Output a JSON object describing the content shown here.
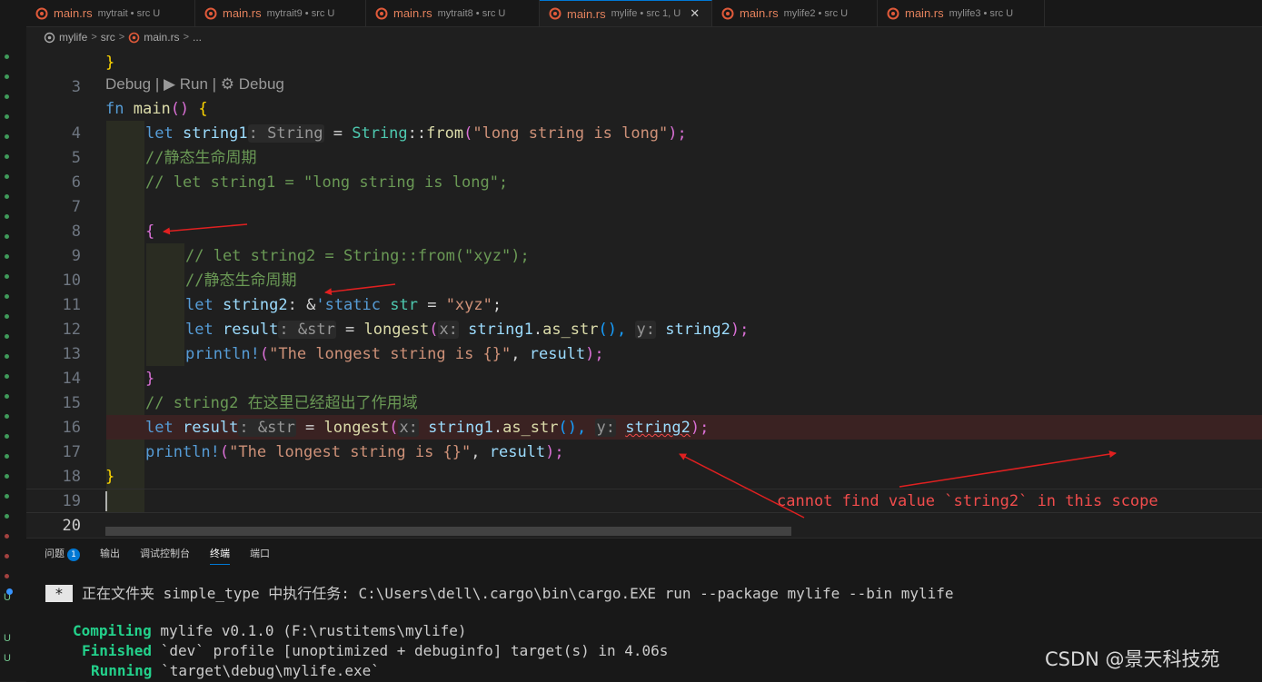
{
  "tabs": [
    {
      "name": "main.rs",
      "desc": "mytrait • src U",
      "active": false,
      "icon": "rust-icon"
    },
    {
      "name": "main.rs",
      "desc": "mytrait9 • src U",
      "active": false,
      "icon": "rust-icon"
    },
    {
      "name": "main.rs",
      "desc": "mytrait8 • src U",
      "active": false,
      "icon": "rust-icon"
    },
    {
      "name": "main.rs",
      "desc": "mylife • src 1, U",
      "active": true,
      "icon": "rust-icon",
      "close": "✕"
    },
    {
      "name": "main.rs",
      "desc": "mylife2 • src U",
      "active": false,
      "icon": "rust-icon"
    },
    {
      "name": "main.rs",
      "desc": "mylife3 • src U",
      "active": false,
      "icon": "rust-icon"
    }
  ],
  "breadcrumb": {
    "items": [
      "mylife",
      "src",
      "main.rs",
      "..."
    ],
    "separator": ">"
  },
  "codelens": "Debug | ▶ Run | ⚙ Debug",
  "editor": {
    "line_numbers": [
      "3",
      "4",
      "5",
      "6",
      "7",
      "8",
      "9",
      "10",
      "11",
      "12",
      "13",
      "14",
      "15",
      "16",
      "17",
      "18",
      "19",
      "20"
    ],
    "current_line": "20",
    "lines": {
      "l3": [
        "}"
      ],
      "l4": [
        "fn",
        " ",
        "main",
        "() ",
        "{"
      ],
      "l5": [
        "let",
        " ",
        "string1",
        ": String",
        " = ",
        "String",
        "::",
        "from",
        "(",
        "\"long string is long\"",
        ");"
      ],
      "l6": [
        "//静态生命周期"
      ],
      "l7": [
        "// let string1 = \"long string is long\";"
      ],
      "l9": [
        "{"
      ],
      "l10": [
        "// let string2 = String::from(\"xyz\");"
      ],
      "l11": [
        "//静态生命周期"
      ],
      "l12": [
        "let",
        " ",
        "string2",
        ": &",
        "'static",
        " ",
        "str",
        " = ",
        "\"xyz\"",
        ";"
      ],
      "l13": [
        "let",
        " ",
        "result",
        ": &str",
        " = ",
        "longest",
        "(",
        "x:",
        " ",
        "string1",
        ".",
        "as_str",
        "(),",
        " ",
        "y:",
        " ",
        "string2",
        ");"
      ],
      "l14": [
        "println!",
        "(",
        "\"The longest string is {}\"",
        ", ",
        "result",
        ");"
      ],
      "l15": [
        "}"
      ],
      "l16": [
        "// string2 在这里已经超出了作用域"
      ],
      "l17": [
        "let",
        " ",
        "result",
        ": &str",
        " = ",
        "longest",
        "(",
        "x:",
        " ",
        "string1",
        ".",
        "as_str",
        "(),",
        " ",
        "y:",
        " ",
        "string2",
        ");"
      ],
      "l18": [
        "println!",
        "(",
        "\"The longest string is {}\"",
        ", ",
        "result",
        ");"
      ],
      "l19": [
        "}"
      ]
    },
    "error_message": "cannot find value `string2` in this scope"
  },
  "panel": {
    "tabs": [
      "问题",
      "输出",
      "调试控制台",
      "终端",
      "端口"
    ],
    "active_tab": "终端",
    "problems_count": "1"
  },
  "terminal": {
    "task_marker": "*",
    "task_line": "正在文件夹 simple_type 中执行任务: C:\\Users\\dell\\.cargo\\bin\\cargo.EXE run --package mylife --bin mylife",
    "lines": [
      {
        "status": "Compiling",
        "text": " mylife v0.1.0 (F:\\rustitems\\mylife)"
      },
      {
        "status": "Finished",
        "text": " `dev` profile [unoptimized + debuginfo] target(s) in 4.06s"
      },
      {
        "status": "Running",
        "text": " `target\\debug\\mylife.exe`"
      }
    ]
  },
  "watermark": "CSDN @景天科技苑",
  "colors": {
    "background": "#1f1f1f",
    "keyword": "#569cd6",
    "function": "#dcdcaa",
    "type": "#4ec9b0",
    "variable": "#9cdcfe",
    "string": "#ce9178",
    "comment": "#6a9955",
    "error": "#f14c4c",
    "annotation_arrow": "#e02020",
    "terminal_green": "#23d18b",
    "accent": "#0078d4"
  }
}
